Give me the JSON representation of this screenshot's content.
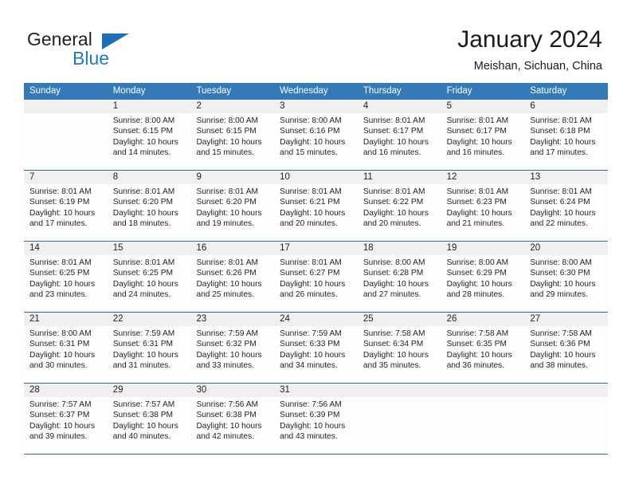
{
  "brand": {
    "word1": "General",
    "word2": "Blue",
    "flag_icon": "triangle-flag-icon",
    "accent_color": "#1f7ac4"
  },
  "header": {
    "title": "January 2024",
    "subtitle": "Meishan, Sichuan, China",
    "header_bg_color": "#3479b8",
    "row_divider_color": "#2e6da4",
    "date_band_color": "#f0f0f0"
  },
  "weekdays": [
    "Sunday",
    "Monday",
    "Tuesday",
    "Wednesday",
    "Thursday",
    "Friday",
    "Saturday"
  ],
  "weeks": [
    [
      {
        "day": "",
        "lines": []
      },
      {
        "day": "1",
        "lines": [
          "Sunrise: 8:00 AM",
          "Sunset: 6:15 PM",
          "Daylight: 10 hours",
          "and 14 minutes."
        ]
      },
      {
        "day": "2",
        "lines": [
          "Sunrise: 8:00 AM",
          "Sunset: 6:15 PM",
          "Daylight: 10 hours",
          "and 15 minutes."
        ]
      },
      {
        "day": "3",
        "lines": [
          "Sunrise: 8:00 AM",
          "Sunset: 6:16 PM",
          "Daylight: 10 hours",
          "and 15 minutes."
        ]
      },
      {
        "day": "4",
        "lines": [
          "Sunrise: 8:01 AM",
          "Sunset: 6:17 PM",
          "Daylight: 10 hours",
          "and 16 minutes."
        ]
      },
      {
        "day": "5",
        "lines": [
          "Sunrise: 8:01 AM",
          "Sunset: 6:17 PM",
          "Daylight: 10 hours",
          "and 16 minutes."
        ]
      },
      {
        "day": "6",
        "lines": [
          "Sunrise: 8:01 AM",
          "Sunset: 6:18 PM",
          "Daylight: 10 hours",
          "and 17 minutes."
        ]
      }
    ],
    [
      {
        "day": "7",
        "lines": [
          "Sunrise: 8:01 AM",
          "Sunset: 6:19 PM",
          "Daylight: 10 hours",
          "and 17 minutes."
        ]
      },
      {
        "day": "8",
        "lines": [
          "Sunrise: 8:01 AM",
          "Sunset: 6:20 PM",
          "Daylight: 10 hours",
          "and 18 minutes."
        ]
      },
      {
        "day": "9",
        "lines": [
          "Sunrise: 8:01 AM",
          "Sunset: 6:20 PM",
          "Daylight: 10 hours",
          "and 19 minutes."
        ]
      },
      {
        "day": "10",
        "lines": [
          "Sunrise: 8:01 AM",
          "Sunset: 6:21 PM",
          "Daylight: 10 hours",
          "and 20 minutes."
        ]
      },
      {
        "day": "11",
        "lines": [
          "Sunrise: 8:01 AM",
          "Sunset: 6:22 PM",
          "Daylight: 10 hours",
          "and 20 minutes."
        ]
      },
      {
        "day": "12",
        "lines": [
          "Sunrise: 8:01 AM",
          "Sunset: 6:23 PM",
          "Daylight: 10 hours",
          "and 21 minutes."
        ]
      },
      {
        "day": "13",
        "lines": [
          "Sunrise: 8:01 AM",
          "Sunset: 6:24 PM",
          "Daylight: 10 hours",
          "and 22 minutes."
        ]
      }
    ],
    [
      {
        "day": "14",
        "lines": [
          "Sunrise: 8:01 AM",
          "Sunset: 6:25 PM",
          "Daylight: 10 hours",
          "and 23 minutes."
        ]
      },
      {
        "day": "15",
        "lines": [
          "Sunrise: 8:01 AM",
          "Sunset: 6:25 PM",
          "Daylight: 10 hours",
          "and 24 minutes."
        ]
      },
      {
        "day": "16",
        "lines": [
          "Sunrise: 8:01 AM",
          "Sunset: 6:26 PM",
          "Daylight: 10 hours",
          "and 25 minutes."
        ]
      },
      {
        "day": "17",
        "lines": [
          "Sunrise: 8:01 AM",
          "Sunset: 6:27 PM",
          "Daylight: 10 hours",
          "and 26 minutes."
        ]
      },
      {
        "day": "18",
        "lines": [
          "Sunrise: 8:00 AM",
          "Sunset: 6:28 PM",
          "Daylight: 10 hours",
          "and 27 minutes."
        ]
      },
      {
        "day": "19",
        "lines": [
          "Sunrise: 8:00 AM",
          "Sunset: 6:29 PM",
          "Daylight: 10 hours",
          "and 28 minutes."
        ]
      },
      {
        "day": "20",
        "lines": [
          "Sunrise: 8:00 AM",
          "Sunset: 6:30 PM",
          "Daylight: 10 hours",
          "and 29 minutes."
        ]
      }
    ],
    [
      {
        "day": "21",
        "lines": [
          "Sunrise: 8:00 AM",
          "Sunset: 6:31 PM",
          "Daylight: 10 hours",
          "and 30 minutes."
        ]
      },
      {
        "day": "22",
        "lines": [
          "Sunrise: 7:59 AM",
          "Sunset: 6:31 PM",
          "Daylight: 10 hours",
          "and 31 minutes."
        ]
      },
      {
        "day": "23",
        "lines": [
          "Sunrise: 7:59 AM",
          "Sunset: 6:32 PM",
          "Daylight: 10 hours",
          "and 33 minutes."
        ]
      },
      {
        "day": "24",
        "lines": [
          "Sunrise: 7:59 AM",
          "Sunset: 6:33 PM",
          "Daylight: 10 hours",
          "and 34 minutes."
        ]
      },
      {
        "day": "25",
        "lines": [
          "Sunrise: 7:58 AM",
          "Sunset: 6:34 PM",
          "Daylight: 10 hours",
          "and 35 minutes."
        ]
      },
      {
        "day": "26",
        "lines": [
          "Sunrise: 7:58 AM",
          "Sunset: 6:35 PM",
          "Daylight: 10 hours",
          "and 36 minutes."
        ]
      },
      {
        "day": "27",
        "lines": [
          "Sunrise: 7:58 AM",
          "Sunset: 6:36 PM",
          "Daylight: 10 hours",
          "and 38 minutes."
        ]
      }
    ],
    [
      {
        "day": "28",
        "lines": [
          "Sunrise: 7:57 AM",
          "Sunset: 6:37 PM",
          "Daylight: 10 hours",
          "and 39 minutes."
        ]
      },
      {
        "day": "29",
        "lines": [
          "Sunrise: 7:57 AM",
          "Sunset: 6:38 PM",
          "Daylight: 10 hours",
          "and 40 minutes."
        ]
      },
      {
        "day": "30",
        "lines": [
          "Sunrise: 7:56 AM",
          "Sunset: 6:38 PM",
          "Daylight: 10 hours",
          "and 42 minutes."
        ]
      },
      {
        "day": "31",
        "lines": [
          "Sunrise: 7:56 AM",
          "Sunset: 6:39 PM",
          "Daylight: 10 hours",
          "and 43 minutes."
        ]
      },
      {
        "day": "",
        "lines": []
      },
      {
        "day": "",
        "lines": []
      },
      {
        "day": "",
        "lines": []
      }
    ]
  ]
}
